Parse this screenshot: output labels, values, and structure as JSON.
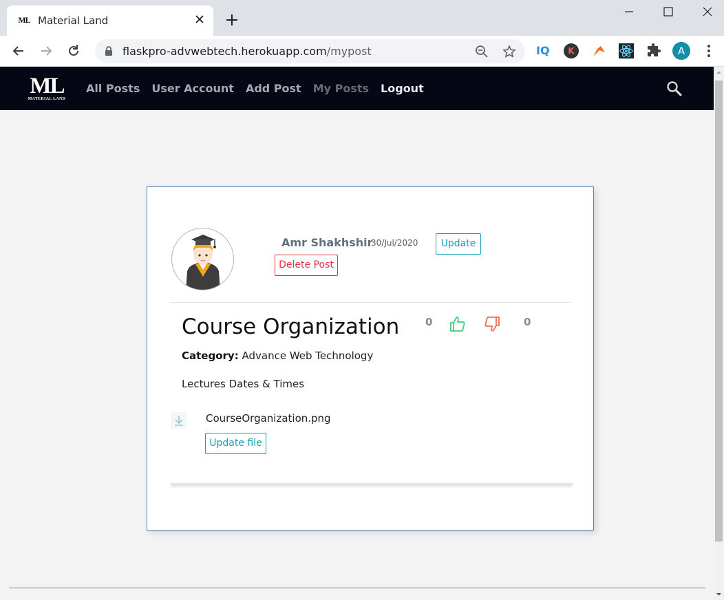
{
  "browser": {
    "tab_title": "Material Land",
    "favicon_text": "ML",
    "url_host": "flaskpro-advwebtech.herokuapp.com",
    "url_path": "/mypost",
    "profile_initial": "A",
    "ext_iq_label": "IQ",
    "ext_k_label": "K"
  },
  "nav": {
    "logo_main": "ML",
    "logo_sub": "MATERIAL LAND",
    "links": [
      "All Posts",
      "User Account",
      "Add Post",
      "My Posts",
      "Logout"
    ]
  },
  "post": {
    "author": "Amr Shakhshir",
    "date": "30/Jul/2020",
    "update_label": "Update",
    "delete_label": "Delete Post",
    "title": "Course Organization",
    "likes": "0",
    "dislikes": "0",
    "category_label": "Category:",
    "category_value": "Advance Web Technology",
    "description": "Lectures Dates & Times",
    "file_name": "CourseOrganization.png",
    "update_file_label": "Update file"
  },
  "colors": {
    "nav_bg": "#050814",
    "info": "#17a2b8",
    "danger": "#dc3545",
    "like": "#3ecf7a",
    "dislike": "#f26b5b"
  }
}
